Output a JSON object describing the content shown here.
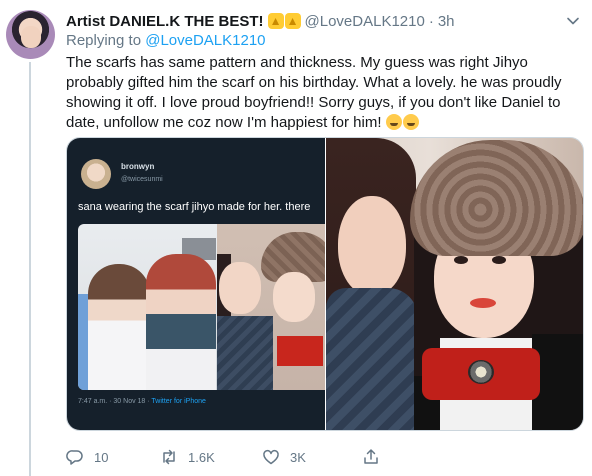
{
  "tweet": {
    "author_name": "Artist DANIEL.K THE BEST!",
    "author_handle": "@LoveDALK1210",
    "separator": "·",
    "time": "3h",
    "replying_prefix": "Replying to",
    "replying_to": "@LoveDALK1210",
    "text": "The scarfs has same pattern and thickness. My guess was right Jihyo probably gifted him the scarf on his birthday. What a lovely. he was proudly showing it off. I love proud boyfriend!! Sorry guys, if you don't like Daniel to date, unfollow me coz now I'm happiest for him!",
    "emojis": [
      "laughing-emoji",
      "laughing-emoji"
    ]
  },
  "embedded_screenshot": {
    "name": "bronwyn",
    "handle": "@twicesunmi",
    "text": "sana wearing the scarf jihyo made for her. there",
    "time": "7:47 a.m. · 30 Nov 18 · ",
    "via": "Twitter for iPhone"
  },
  "actions": {
    "reply_count": "10",
    "retweet_count": "1.6K",
    "like_count": "3K"
  },
  "colors": {
    "link": "#1da1f2",
    "secondary_text": "#657786",
    "primary_text": "#14171a",
    "dark_card": "#15202b"
  }
}
